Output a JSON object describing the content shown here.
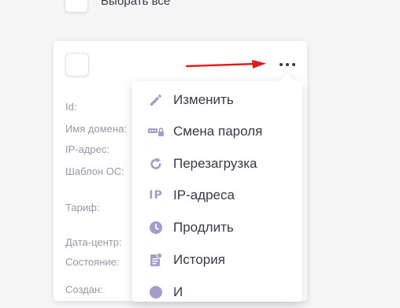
{
  "select_all": {
    "label": "Выбрать все"
  },
  "card": {
    "fields": {
      "id": "Id:",
      "domain": "Имя домена:",
      "ip": "IP-адрес:",
      "os_template": "Шаблон ОС:",
      "tariff": "Тариф:",
      "datacenter": "Дата-центр:",
      "state": "Состояние:",
      "created": "Создан:"
    }
  },
  "menu": {
    "items": [
      {
        "label": "Изменить",
        "icon": "pencil-icon"
      },
      {
        "label": "Смена пароля",
        "icon": "password-key-icon"
      },
      {
        "label": "Перезагрузка",
        "icon": "refresh-icon"
      },
      {
        "label": "IP-адреса",
        "icon": "ip-icon",
        "glyph": "IP"
      },
      {
        "label": "Продлить",
        "icon": "clock-icon"
      },
      {
        "label": "История",
        "icon": "history-document-icon"
      },
      {
        "label": "И",
        "icon": "info-icon"
      }
    ]
  },
  "colors": {
    "accent_icon": "#a79bc9",
    "annotation_arrow": "#e01b1b"
  }
}
